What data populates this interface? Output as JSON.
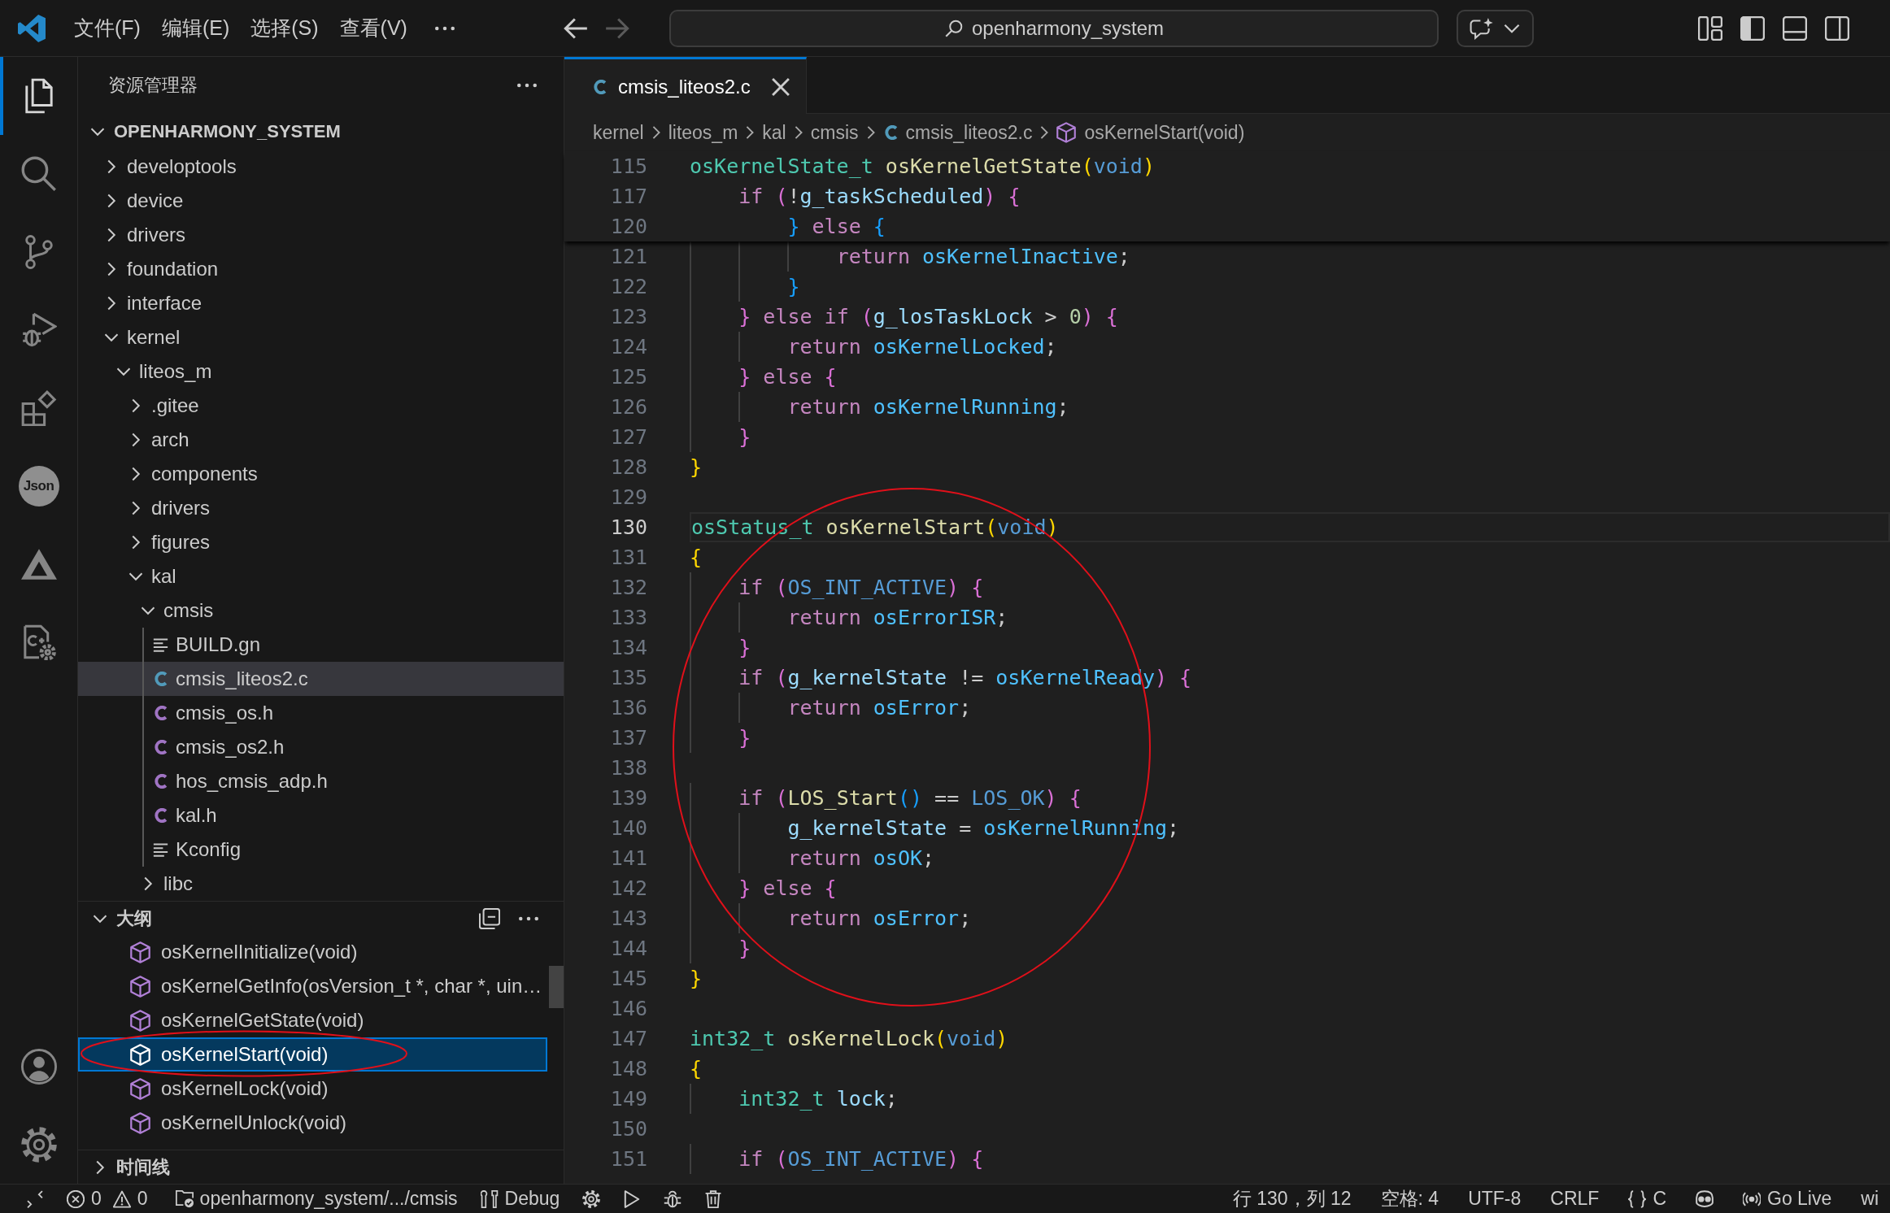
{
  "title_bar": {
    "menus": [
      {
        "label": "文件(F)"
      },
      {
        "label": "编辑(E)"
      },
      {
        "label": "选择(S)"
      },
      {
        "label": "查看(V)"
      }
    ],
    "navigation": [
      {
        "kind": "back",
        "disabled": false
      },
      {
        "kind": "forward",
        "disabled": true
      }
    ],
    "command_center": {
      "label": "openharmony_system"
    },
    "layout_toggles": [
      {
        "kind": "primary-sidebar",
        "on": true
      },
      {
        "kind": "panel",
        "on": false
      },
      {
        "kind": "secondary-sidebar",
        "on": false
      }
    ]
  },
  "activity_bar": {
    "items": [
      {
        "kind": "explorer",
        "selected": true
      },
      {
        "kind": "search",
        "selected": false
      },
      {
        "kind": "source-control",
        "selected": false
      },
      {
        "kind": "run-debug",
        "selected": false
      },
      {
        "kind": "extensions",
        "selected": false
      },
      {
        "kind": "json",
        "label": "Json",
        "selected": false
      },
      {
        "kind": "triangle",
        "selected": false
      },
      {
        "kind": "file-gear",
        "selected": false
      }
    ],
    "bottom_items": [
      {
        "kind": "account"
      },
      {
        "kind": "settings"
      }
    ]
  },
  "explorer": {
    "title": "资源管理器",
    "root": {
      "label": "OPENHARMONY_SYSTEM",
      "expanded": true
    },
    "tree": [
      {
        "label": "developtools",
        "kind": "folder",
        "expanded": false,
        "selected": false
      },
      {
        "label": "device",
        "kind": "folder",
        "expanded": false,
        "selected": false
      },
      {
        "label": "drivers",
        "kind": "folder",
        "expanded": false,
        "selected": false
      },
      {
        "label": "foundation",
        "kind": "folder",
        "expanded": false,
        "selected": false
      },
      {
        "label": "interface",
        "kind": "folder",
        "expanded": false,
        "selected": false
      },
      {
        "label": "kernel",
        "kind": "folder",
        "expanded": true,
        "selected": false,
        "children": [
          {
            "label": "liteos_m",
            "kind": "folder",
            "expanded": true,
            "selected": false,
            "children": [
              {
                "label": ".gitee",
                "kind": "folder",
                "expanded": false,
                "selected": false
              },
              {
                "label": "arch",
                "kind": "folder",
                "expanded": false,
                "selected": false
              },
              {
                "label": "components",
                "kind": "folder",
                "expanded": false,
                "selected": false
              },
              {
                "label": "drivers",
                "kind": "folder",
                "expanded": false,
                "selected": false
              },
              {
                "label": "figures",
                "kind": "folder",
                "expanded": false,
                "selected": false
              },
              {
                "label": "kal",
                "kind": "folder",
                "expanded": true,
                "selected": false,
                "children": [
                  {
                    "label": "cmsis",
                    "kind": "folder",
                    "expanded": true,
                    "selected": false,
                    "children": [
                      {
                        "label": "BUILD.gn",
                        "kind": "text-file",
                        "selected": false
                      },
                      {
                        "label": "cmsis_liteos2.c",
                        "kind": "c-source",
                        "selected": true
                      },
                      {
                        "label": "cmsis_os.h",
                        "kind": "c-header",
                        "selected": false
                      },
                      {
                        "label": "cmsis_os2.h",
                        "kind": "c-header",
                        "selected": false
                      },
                      {
                        "label": "hos_cmsis_adp.h",
                        "kind": "c-header",
                        "selected": false
                      },
                      {
                        "label": "kal.h",
                        "kind": "c-header",
                        "selected": false
                      },
                      {
                        "label": "Kconfig",
                        "kind": "text-file",
                        "selected": false
                      }
                    ]
                  },
                  {
                    "label": "libc",
                    "kind": "folder",
                    "expanded": false,
                    "selected": false
                  }
                ]
              }
            ]
          }
        ]
      }
    ]
  },
  "outline": {
    "title": "大纲",
    "expanded": true,
    "items": [
      {
        "label": "osKernelInitialize(void)",
        "selected": false,
        "circled": false
      },
      {
        "label": "osKernelGetInfo(osVersion_t *, char *, uin…",
        "selected": false,
        "circled": false
      },
      {
        "label": "osKernelGetState(void)",
        "selected": false,
        "circled": false
      },
      {
        "label": "osKernelStart(void)",
        "selected": true,
        "circled": true
      },
      {
        "label": "osKernelLock(void)",
        "selected": false,
        "circled": false
      },
      {
        "label": "osKernelUnlock(void)",
        "selected": false,
        "circled": false
      }
    ]
  },
  "timeline": {
    "title": "时间线",
    "expanded": false
  },
  "editor": {
    "tabs": [
      {
        "label": "cmsis_liteos2.c",
        "kind": "c-source",
        "selected": true
      }
    ],
    "breadcrumbs": [
      {
        "label": "kernel",
        "kind": "folder"
      },
      {
        "label": "liteos_m",
        "kind": "folder"
      },
      {
        "label": "kal",
        "kind": "folder"
      },
      {
        "label": "cmsis",
        "kind": "folder"
      },
      {
        "label": "cmsis_liteos2.c",
        "kind": "c-source"
      },
      {
        "label": "osKernelStart(void)",
        "kind": "function"
      }
    ],
    "sticky_lines": [
      {
        "number": "115",
        "tokens": [
          {
            "text": "osKernelState_t",
            "kind": "type"
          },
          {
            "text": " osKernelGetState",
            "kind": "function"
          },
          {
            "text": "(",
            "kind": "bracket-1"
          },
          {
            "text": "void",
            "kind": "storage"
          },
          {
            "text": ")",
            "kind": "bracket-1"
          }
        ]
      },
      {
        "number": "117",
        "tokens": [
          {
            "text": "    if",
            "kind": "keyword"
          },
          {
            "text": " (",
            "kind": "bracket-2"
          },
          {
            "text": "!",
            "kind": "plain"
          },
          {
            "text": "g_taskScheduled",
            "kind": "variable"
          },
          {
            "text": ")",
            "kind": "bracket-2"
          },
          {
            "text": " {",
            "kind": "bracket-2"
          }
        ]
      },
      {
        "number": "120",
        "tokens": [
          {
            "text": "        }",
            "kind": "bracket-3"
          },
          {
            "text": " else",
            "kind": "keyword"
          },
          {
            "text": " {",
            "kind": "bracket-3"
          }
        ]
      }
    ],
    "lines": [
      {
        "number": "121",
        "current": false,
        "tokens": [
          {
            "text": "            return",
            "kind": "keyword"
          },
          {
            "text": " osKernelInactive",
            "kind": "constant"
          },
          {
            "text": ";",
            "kind": "plain"
          }
        ]
      },
      {
        "number": "122",
        "current": false,
        "tokens": [
          {
            "text": "        }",
            "kind": "bracket-3"
          }
        ]
      },
      {
        "number": "123",
        "current": false,
        "tokens": [
          {
            "text": "    }",
            "kind": "bracket-2"
          },
          {
            "text": " else",
            "kind": "keyword"
          },
          {
            "text": " if",
            "kind": "keyword"
          },
          {
            "text": " (",
            "kind": "bracket-2"
          },
          {
            "text": "g_losTaskLock",
            "kind": "variable"
          },
          {
            "text": " >",
            "kind": "plain"
          },
          {
            "text": " 0",
            "kind": "number"
          },
          {
            "text": ")",
            "kind": "bracket-2"
          },
          {
            "text": " {",
            "kind": "bracket-2"
          }
        ]
      },
      {
        "number": "124",
        "current": false,
        "tokens": [
          {
            "text": "        return",
            "kind": "keyword"
          },
          {
            "text": " osKernelLocked",
            "kind": "constant"
          },
          {
            "text": ";",
            "kind": "plain"
          }
        ]
      },
      {
        "number": "125",
        "current": false,
        "tokens": [
          {
            "text": "    }",
            "kind": "bracket-2"
          },
          {
            "text": " else",
            "kind": "keyword"
          },
          {
            "text": " {",
            "kind": "bracket-2"
          }
        ]
      },
      {
        "number": "126",
        "current": false,
        "tokens": [
          {
            "text": "        return",
            "kind": "keyword"
          },
          {
            "text": " osKernelRunning",
            "kind": "constant"
          },
          {
            "text": ";",
            "kind": "plain"
          }
        ]
      },
      {
        "number": "127",
        "current": false,
        "tokens": [
          {
            "text": "    }",
            "kind": "bracket-2"
          }
        ]
      },
      {
        "number": "128",
        "current": false,
        "tokens": [
          {
            "text": "}",
            "kind": "bracket-1"
          }
        ]
      },
      {
        "number": "129",
        "current": false
      },
      {
        "number": "130",
        "current": true,
        "tokens": [
          {
            "text": "osStatus_t",
            "kind": "type"
          },
          {
            "text": " osKernelStart",
            "kind": "function"
          },
          {
            "text": "(",
            "kind": "bracket-1"
          },
          {
            "text": "void",
            "kind": "storage"
          },
          {
            "text": ")",
            "kind": "bracket-1"
          }
        ]
      },
      {
        "number": "131",
        "current": false,
        "tokens": [
          {
            "text": "{",
            "kind": "bracket-1"
          }
        ]
      },
      {
        "number": "132",
        "current": false,
        "tokens": [
          {
            "text": "    if",
            "kind": "keyword"
          },
          {
            "text": " (",
            "kind": "bracket-2"
          },
          {
            "text": "OS_INT_ACTIVE",
            "kind": "macro"
          },
          {
            "text": ")",
            "kind": "bracket-2"
          },
          {
            "text": " {",
            "kind": "bracket-2"
          }
        ]
      },
      {
        "number": "133",
        "current": false,
        "tokens": [
          {
            "text": "        return",
            "kind": "keyword"
          },
          {
            "text": " osErrorISR",
            "kind": "constant"
          },
          {
            "text": ";",
            "kind": "plain"
          }
        ]
      },
      {
        "number": "134",
        "current": false,
        "tokens": [
          {
            "text": "    }",
            "kind": "bracket-2"
          }
        ]
      },
      {
        "number": "135",
        "current": false,
        "tokens": [
          {
            "text": "    if",
            "kind": "keyword"
          },
          {
            "text": " (",
            "kind": "bracket-2"
          },
          {
            "text": "g_kernelState",
            "kind": "variable"
          },
          {
            "text": " !=",
            "kind": "plain"
          },
          {
            "text": " osKernelReady",
            "kind": "constant"
          },
          {
            "text": ")",
            "kind": "bracket-2"
          },
          {
            "text": " {",
            "kind": "bracket-2"
          }
        ]
      },
      {
        "number": "136",
        "current": false,
        "tokens": [
          {
            "text": "        return",
            "kind": "keyword"
          },
          {
            "text": " osError",
            "kind": "constant"
          },
          {
            "text": ";",
            "kind": "plain"
          }
        ]
      },
      {
        "number": "137",
        "current": false,
        "tokens": [
          {
            "text": "    }",
            "kind": "bracket-2"
          }
        ]
      },
      {
        "number": "138",
        "current": false
      },
      {
        "number": "139",
        "current": false,
        "tokens": [
          {
            "text": "    if",
            "kind": "keyword"
          },
          {
            "text": " (",
            "kind": "bracket-2"
          },
          {
            "text": "LOS_Start",
            "kind": "function"
          },
          {
            "text": "(",
            "kind": "bracket-3"
          },
          {
            "text": ")",
            "kind": "bracket-3"
          },
          {
            "text": " ==",
            "kind": "plain"
          },
          {
            "text": " LOS_OK",
            "kind": "macro"
          },
          {
            "text": ")",
            "kind": "bracket-2"
          },
          {
            "text": " {",
            "kind": "bracket-2"
          }
        ]
      },
      {
        "number": "140",
        "current": false,
        "tokens": [
          {
            "text": "        g_kernelState",
            "kind": "variable"
          },
          {
            "text": " =",
            "kind": "plain"
          },
          {
            "text": " osKernelRunning",
            "kind": "constant"
          },
          {
            "text": ";",
            "kind": "plain"
          }
        ]
      },
      {
        "number": "141",
        "current": false,
        "tokens": [
          {
            "text": "        return",
            "kind": "keyword"
          },
          {
            "text": " osOK",
            "kind": "constant"
          },
          {
            "text": ";",
            "kind": "plain"
          }
        ]
      },
      {
        "number": "142",
        "current": false,
        "tokens": [
          {
            "text": "    }",
            "kind": "bracket-2"
          },
          {
            "text": " else",
            "kind": "keyword"
          },
          {
            "text": " {",
            "kind": "bracket-2"
          }
        ]
      },
      {
        "number": "143",
        "current": false,
        "tokens": [
          {
            "text": "        return",
            "kind": "keyword"
          },
          {
            "text": " osError",
            "kind": "constant"
          },
          {
            "text": ";",
            "kind": "plain"
          }
        ]
      },
      {
        "number": "144",
        "current": false,
        "tokens": [
          {
            "text": "    }",
            "kind": "bracket-2"
          }
        ]
      },
      {
        "number": "145",
        "current": false,
        "tokens": [
          {
            "text": "}",
            "kind": "bracket-1"
          }
        ]
      },
      {
        "number": "146",
        "current": false
      },
      {
        "number": "147",
        "current": false,
        "tokens": [
          {
            "text": "int32_t",
            "kind": "type"
          },
          {
            "text": " osKernelLock",
            "kind": "function"
          },
          {
            "text": "(",
            "kind": "bracket-1"
          },
          {
            "text": "void",
            "kind": "storage"
          },
          {
            "text": ")",
            "kind": "bracket-1"
          }
        ]
      },
      {
        "number": "148",
        "current": false,
        "tokens": [
          {
            "text": "{",
            "kind": "bracket-1"
          }
        ]
      },
      {
        "number": "149",
        "current": false,
        "tokens": [
          {
            "text": "    int32_t",
            "kind": "type"
          },
          {
            "text": " lock",
            "kind": "variable"
          },
          {
            "text": ";",
            "kind": "plain"
          }
        ]
      },
      {
        "number": "150",
        "current": false
      },
      {
        "number": "151",
        "current": false,
        "tokens": [
          {
            "text": "    if",
            "kind": "keyword"
          },
          {
            "text": " (",
            "kind": "bracket-2"
          },
          {
            "text": "OS_INT_ACTIVE",
            "kind": "macro"
          },
          {
            "text": ")",
            "kind": "bracket-2"
          },
          {
            "text": " {",
            "kind": "bracket-2"
          }
        ]
      }
    ],
    "annotation": {
      "kind": "ellipse"
    }
  },
  "status_bar": {
    "left": [
      {
        "kind": "remote"
      },
      {
        "kind": "problems",
        "errors": "0",
        "warnings": "0"
      },
      {
        "kind": "folder",
        "label": "openharmony_system/.../cmsis"
      },
      {
        "kind": "debug",
        "label": "Debug"
      },
      {
        "kind": "gear"
      },
      {
        "kind": "play"
      },
      {
        "kind": "bug"
      },
      {
        "kind": "trash"
      }
    ],
    "right": [
      {
        "kind": "text",
        "label": "行 130，列 12"
      },
      {
        "kind": "text",
        "label": "空格: 4"
      },
      {
        "kind": "text",
        "label": "UTF-8"
      },
      {
        "kind": "text",
        "label": "CRLF"
      },
      {
        "kind": "language",
        "label": "C"
      },
      {
        "kind": "assistant"
      },
      {
        "kind": "live",
        "label": "Go Live"
      },
      {
        "kind": "text",
        "label": "wi"
      }
    ]
  }
}
